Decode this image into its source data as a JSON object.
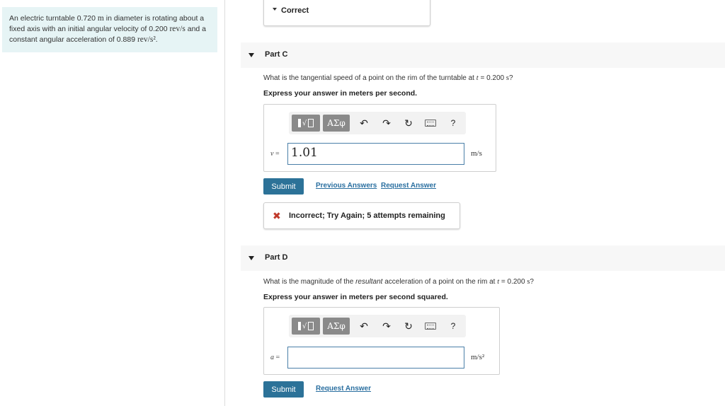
{
  "problem": {
    "text_1": "An electric turntable 0.720 ",
    "unit_m": "m",
    "text_2": " in diameter is rotating about a fixed axis with an initial angular velocity of 0.200 ",
    "unit_revs": "rev/s",
    "text_3": " and a constant angular acceleration of 0.889 ",
    "unit_revs2": "rev/s²",
    "text_4": "."
  },
  "previous_part": {
    "label": "Correct"
  },
  "part_c": {
    "title": "Part C",
    "question_1": "What is the tangential speed of a point on the rim of the turntable at ",
    "question_t": "t",
    "question_2": " = 0.200 ",
    "question_s": "s",
    "question_3": "?",
    "instruction": "Express your answer in meters per second.",
    "variable": "v",
    "equals": " =",
    "input_value": "1.01",
    "unit": "m/s",
    "submit_label": "Submit",
    "previous_answers_label": "Previous Answers",
    "request_answer_label": "Request Answer",
    "feedback_icon": "✖",
    "feedback_text": "Incorrect; Try Again; 5 attempts remaining"
  },
  "part_d": {
    "title": "Part D",
    "question_1": "What is the magnitude of the ",
    "question_em": "resultant",
    "question_2": " acceleration of a point on the rim at ",
    "question_t": "t",
    "question_3": " = 0.200 ",
    "question_s": "s",
    "question_4": "?",
    "instruction": "Express your answer in meters per second squared.",
    "variable": "a",
    "equals": " =",
    "input_value": "",
    "unit": "m/s²",
    "submit_label": "Submit",
    "request_answer_label": "Request Answer"
  },
  "toolbar": {
    "greek_label": "ΑΣφ",
    "undo_icon": "↶",
    "redo_icon": "↷",
    "reset_icon": "↻",
    "help_label": "?"
  },
  "colors": {
    "problem_bg": "#e6f4f5",
    "submit_bg": "#2c7298",
    "link": "#2a6fa0",
    "error": "#c0392b",
    "input_border": "#4a7fa8"
  }
}
